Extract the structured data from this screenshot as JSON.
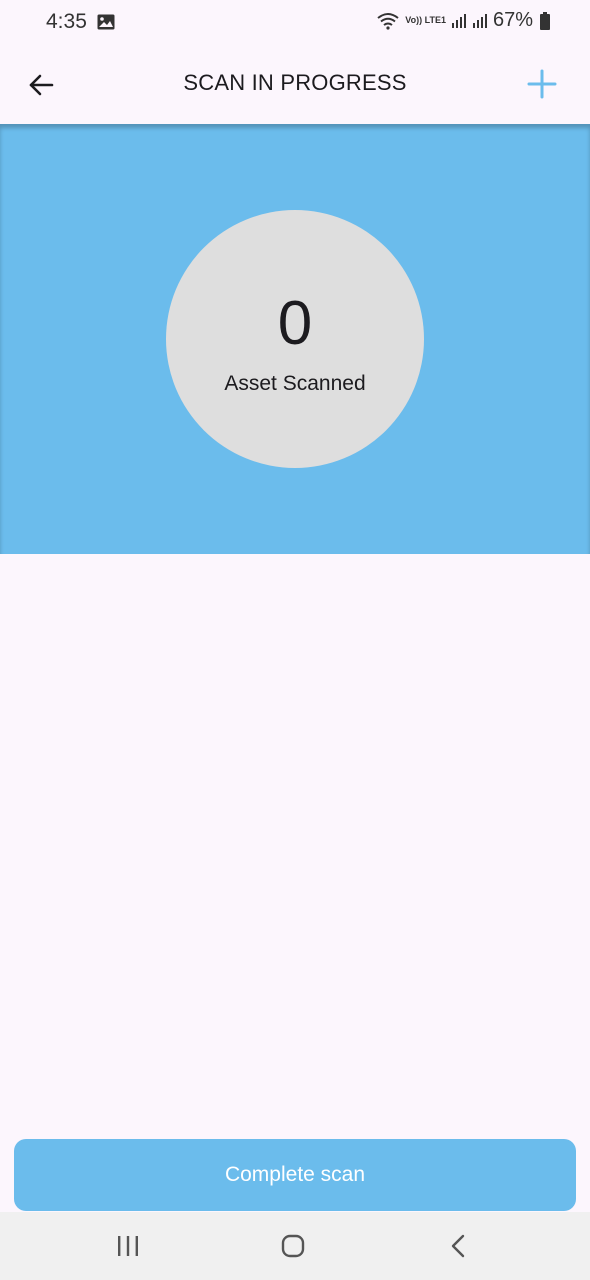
{
  "status_bar": {
    "time": "4:35",
    "network_label": "Vo)) LTE1",
    "battery": "67%"
  },
  "app_bar": {
    "title": "SCAN IN PROGRESS",
    "accent_color": "#6bbcec"
  },
  "scan_summary": {
    "count": "0",
    "label": "Asset Scanned"
  },
  "actions": {
    "complete_label": "Complete scan"
  },
  "icons": {
    "back": "arrow-left-icon",
    "add": "plus-icon",
    "recents": "recent-apps-icon",
    "home": "home-icon",
    "system_back": "chevron-left-icon"
  }
}
